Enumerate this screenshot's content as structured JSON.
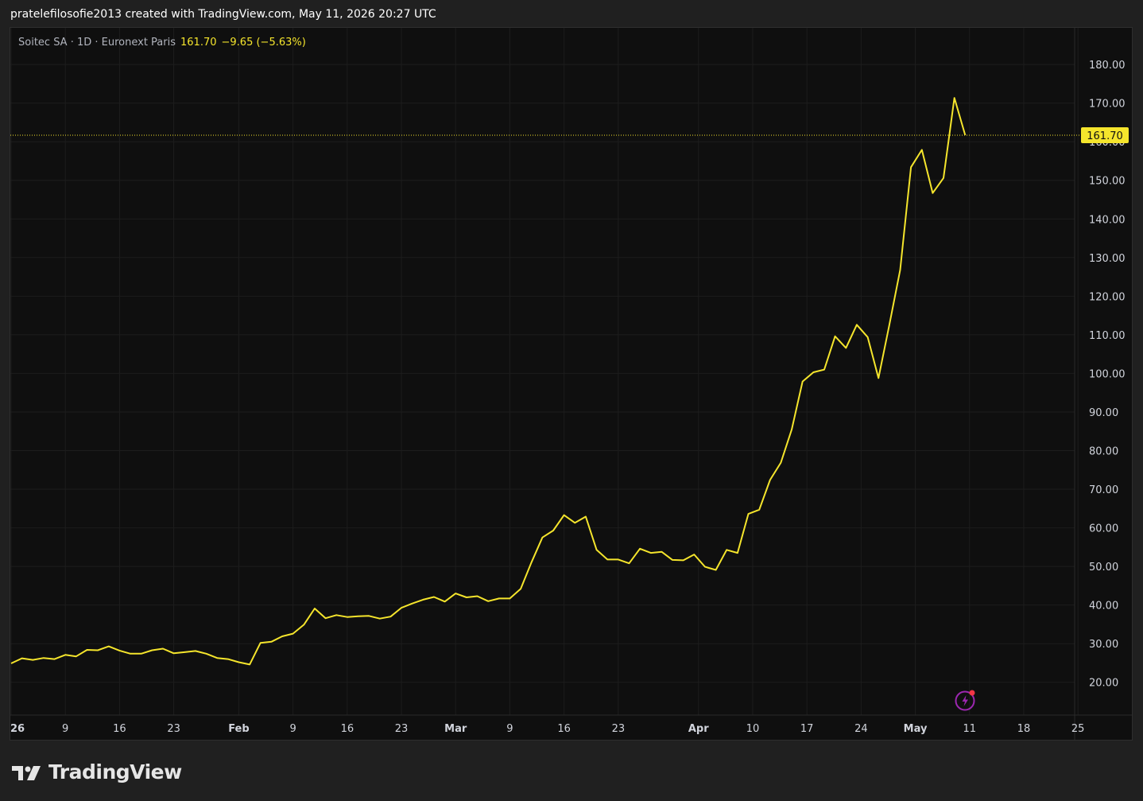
{
  "header": {
    "attribution": "pratelefilosofie2013 created with TradingView.com, May 11, 2026 20:27 UTC"
  },
  "legend": {
    "symbol": "Soitec SA · 1D · Euronext Paris",
    "last": "161.70",
    "change": "−9.65 (−5.63%)"
  },
  "footer": {
    "brand": "TradingView"
  },
  "colors": {
    "line": "#f5e52c",
    "background": "#0f0f0f",
    "grid": "#1d1d1d",
    "axis_text": "#d1d4dc"
  },
  "chart_data": {
    "type": "line",
    "series": [
      {
        "values": [
          24.9,
          26.2,
          25.8,
          26.3,
          26.0,
          27.1,
          26.7,
          28.4,
          28.3,
          29.3,
          28.2,
          27.4,
          27.4,
          28.3,
          28.7,
          27.5,
          27.8,
          28.1,
          27.4,
          26.3,
          26.0,
          25.2,
          24.6,
          30.2,
          30.5,
          31.9,
          32.6,
          34.9,
          39.1,
          36.6,
          37.4,
          36.9,
          37.1,
          37.2,
          36.5,
          37.0,
          39.3,
          40.4,
          41.4,
          42.1,
          40.9,
          43.0,
          42.0,
          42.3,
          41.0,
          41.7,
          41.7,
          44.2,
          51.1,
          57.5,
          59.3,
          63.3,
          61.3,
          62.9,
          54.3,
          51.8,
          51.8,
          50.8,
          54.6,
          53.5,
          53.8,
          51.7,
          51.6,
          53.1,
          49.9,
          49.1,
          54.3,
          53.5,
          63.6,
          64.7,
          72.4,
          76.9,
          85.5,
          97.9,
          100.3,
          101.0,
          109.6,
          106.6,
          112.6,
          109.4,
          98.8,
          112.5,
          126.8,
          153.4,
          157.9,
          146.7,
          150.6,
          171.35,
          161.7
        ]
      }
    ],
    "x_ticks": [
      {
        "i": 0,
        "label": "26",
        "bold": true
      },
      {
        "i": 5,
        "label": "9"
      },
      {
        "i": 10,
        "label": "16"
      },
      {
        "i": 15,
        "label": "23"
      },
      {
        "i": 21,
        "label": "Feb",
        "bold": true
      },
      {
        "i": 26,
        "label": "9"
      },
      {
        "i": 31,
        "label": "16"
      },
      {
        "i": 36,
        "label": "23"
      },
      {
        "i": 41,
        "label": "Mar",
        "bold": true
      },
      {
        "i": 46,
        "label": "9"
      },
      {
        "i": 51,
        "label": "16"
      },
      {
        "i": 56,
        "label": "23"
      },
      {
        "i": 63.4,
        "label": "Apr",
        "bold": true
      },
      {
        "i": 68.4,
        "label": "10"
      },
      {
        "i": 73.4,
        "label": "17"
      },
      {
        "i": 78.4,
        "label": "24"
      },
      {
        "i": 83.4,
        "label": "May",
        "bold": true
      },
      {
        "i": 88.4,
        "label": "11"
      },
      {
        "i": 93.4,
        "label": "18"
      },
      {
        "i": 98.4,
        "label": "25"
      }
    ],
    "y_ticks": [
      "180.00",
      "170.00",
      "160.00",
      "150.00",
      "140.00",
      "130.00",
      "120.00",
      "110.00",
      "100.00",
      "90.00",
      "80.00",
      "70.00",
      "60.00",
      "50.00",
      "40.00",
      "30.00",
      "20.00"
    ],
    "y_tick_values": [
      180,
      170,
      160,
      150,
      140,
      130,
      120,
      110,
      100,
      90,
      80,
      70,
      60,
      50,
      40,
      30,
      20
    ],
    "last_price_label": "161.70",
    "last_price": 161.7,
    "ylim": [
      11.5,
      189.5
    ],
    "grid": true
  }
}
